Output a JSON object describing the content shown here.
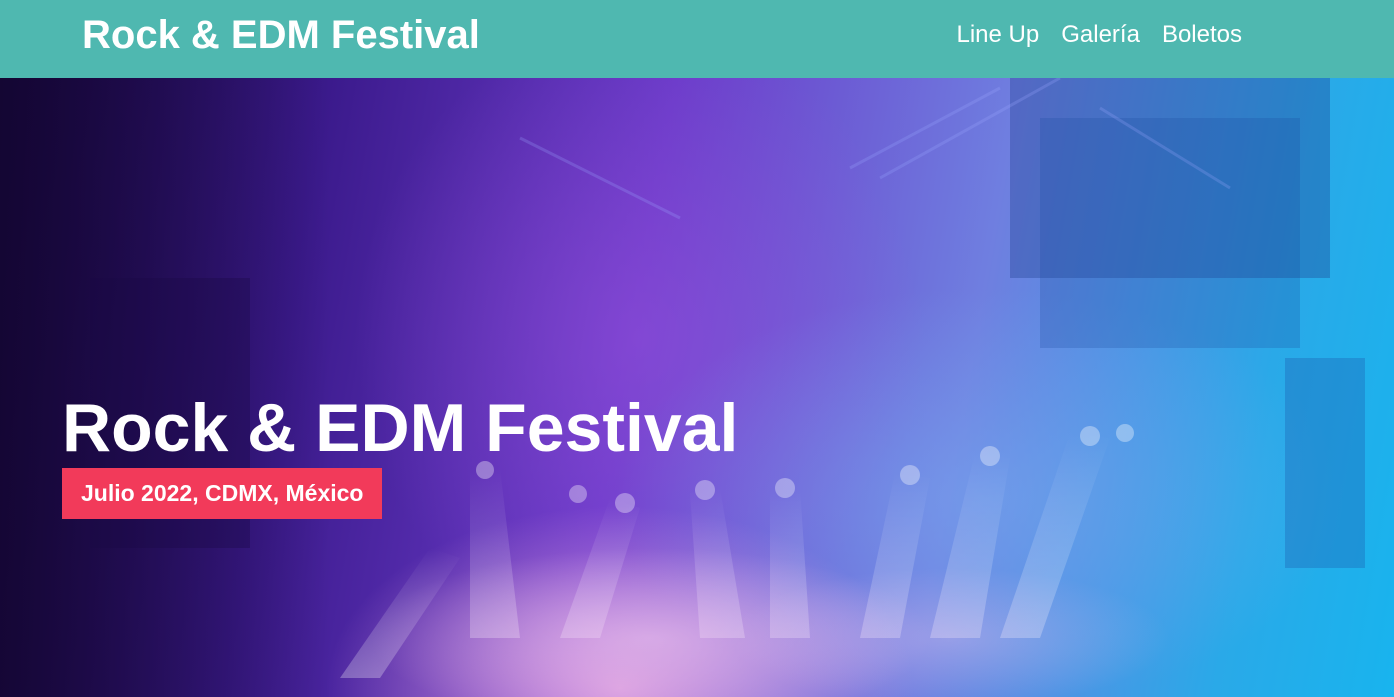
{
  "header": {
    "logo_text": "Rock & EDM Festival",
    "nav": [
      {
        "label": "Line Up"
      },
      {
        "label": "Galería"
      },
      {
        "label": "Boletos"
      }
    ]
  },
  "hero": {
    "title": "Rock & EDM Festival",
    "date_location": "Julio 2022, CDMX, México"
  },
  "colors": {
    "header_bg": "#4fb8b0",
    "badge_bg": "#f23a5a",
    "text": "#ffffff"
  }
}
